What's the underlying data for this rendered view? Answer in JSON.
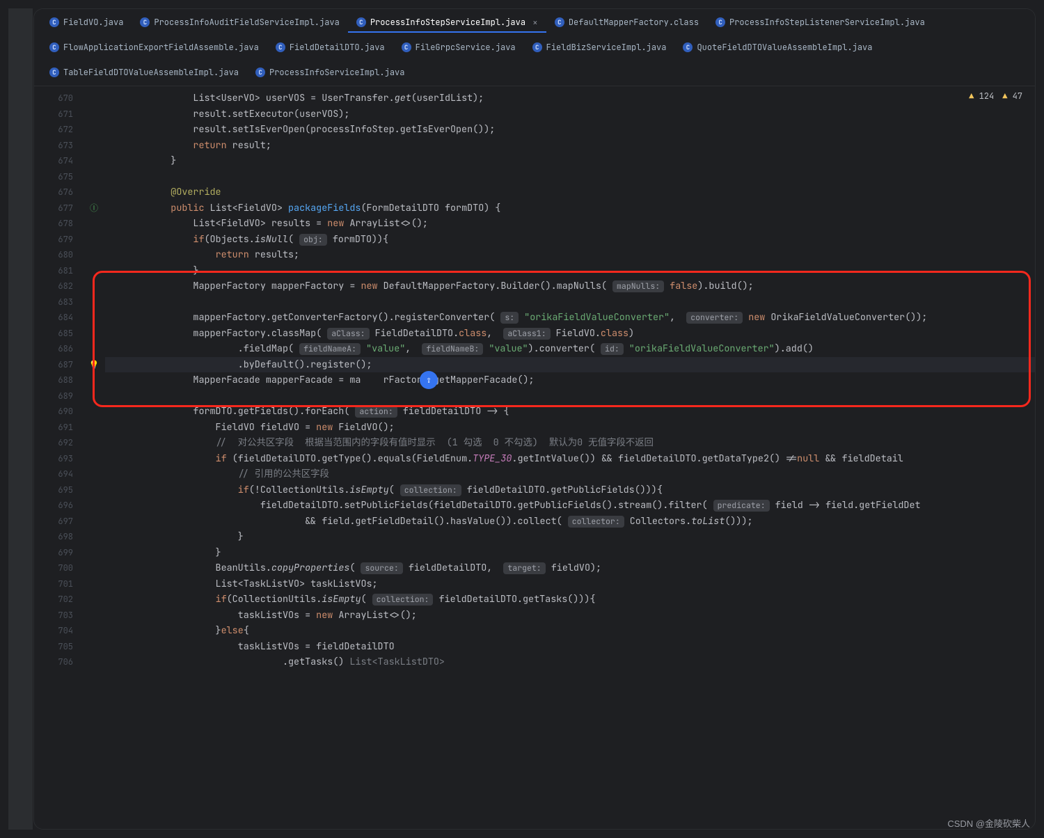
{
  "tabs_rows": [
    [
      {
        "label": "FieldVO.java",
        "active": false
      },
      {
        "label": "ProcessInfoAuditFieldServiceImpl.java",
        "active": false
      },
      {
        "label": "ProcessInfoStepServiceImpl.java",
        "active": true,
        "closable": true
      },
      {
        "label": "DefaultMapperFactory.class",
        "active": false
      },
      {
        "label": "ProcessInfoStepListenerServiceImpl.java",
        "active": false
      }
    ],
    [
      {
        "label": "FlowApplicationExportFieldAssemble.java",
        "active": false
      },
      {
        "label": "FieldDetailDTO.java",
        "active": false
      },
      {
        "label": "FileGrpcService.java",
        "active": false
      },
      {
        "label": "FieldBizServiceImpl.java",
        "active": false
      },
      {
        "label": "QuoteFieldDTOValueAssembleImpl.java",
        "active": false
      }
    ],
    [
      {
        "label": "TableFieldDTOValueAssembleImpl.java",
        "active": false
      },
      {
        "label": "ProcessInfoServiceImpl.java",
        "active": false
      }
    ]
  ],
  "inspect": {
    "warn1": "124",
    "warn2": "47"
  },
  "gutter_marks": {
    "677": "impl",
    "687": "bulb"
  },
  "highlight_line": 687,
  "lines": [
    {
      "n": 670,
      "seg": [
        {
          "t": "            List<UserVO> userVOS = UserTransfer."
        },
        {
          "t": "get",
          "c": "it"
        },
        {
          "t": "(userIdList);"
        }
      ]
    },
    {
      "n": 671,
      "seg": [
        {
          "t": "            result.setExecutor(userVOS);"
        }
      ]
    },
    {
      "n": 672,
      "seg": [
        {
          "t": "            result.setIsEverOpen(processInfoStep.getIsEverOpen());"
        }
      ]
    },
    {
      "n": 673,
      "seg": [
        {
          "t": "            "
        },
        {
          "t": "return",
          "c": "kw"
        },
        {
          "t": " result;"
        }
      ]
    },
    {
      "n": 674,
      "seg": [
        {
          "t": "        }"
        }
      ]
    },
    {
      "n": 675,
      "seg": [
        {
          "t": ""
        }
      ]
    },
    {
      "n": 676,
      "seg": [
        {
          "t": "        "
        },
        {
          "t": "@Override",
          "c": "ann"
        }
      ]
    },
    {
      "n": 677,
      "seg": [
        {
          "t": "        "
        },
        {
          "t": "public",
          "c": "kw"
        },
        {
          "t": " List<FieldVO> "
        },
        {
          "t": "packageFields",
          "c": "fn"
        },
        {
          "t": "(FormDetailDTO formDTO) {"
        }
      ]
    },
    {
      "n": 678,
      "seg": [
        {
          "t": "            List<FieldVO> results = "
        },
        {
          "t": "new",
          "c": "kw"
        },
        {
          "t": " ArrayList<>();"
        }
      ]
    },
    {
      "n": 679,
      "seg": [
        {
          "t": "            "
        },
        {
          "t": "if",
          "c": "kw"
        },
        {
          "t": "(Objects."
        },
        {
          "t": "isNull",
          "c": "it"
        },
        {
          "t": "( "
        },
        {
          "t": "obj:",
          "c": "pill"
        },
        {
          "t": " formDTO)){"
        }
      ]
    },
    {
      "n": 680,
      "seg": [
        {
          "t": "                "
        },
        {
          "t": "return",
          "c": "kw"
        },
        {
          "t": " results;"
        }
      ]
    },
    {
      "n": 681,
      "seg": [
        {
          "t": "            }"
        }
      ]
    },
    {
      "n": 682,
      "seg": [
        {
          "t": "            MapperFactory mapperFactory = "
        },
        {
          "t": "new",
          "c": "kw"
        },
        {
          "t": " DefaultMapperFactory.Builder().mapNulls( "
        },
        {
          "t": "mapNulls:",
          "c": "pill"
        },
        {
          "t": " "
        },
        {
          "t": "false",
          "c": "kw"
        },
        {
          "t": ").build();"
        }
      ]
    },
    {
      "n": 683,
      "seg": [
        {
          "t": ""
        }
      ]
    },
    {
      "n": 684,
      "seg": [
        {
          "t": "            mapperFactory.getConverterFactory().registerConverter( "
        },
        {
          "t": "s:",
          "c": "pill"
        },
        {
          "t": " "
        },
        {
          "t": "\"orikaFieldValueConverter\"",
          "c": "s"
        },
        {
          "t": ",  "
        },
        {
          "t": "converter:",
          "c": "pill"
        },
        {
          "t": " "
        },
        {
          "t": "new",
          "c": "kw"
        },
        {
          "t": " OrikaFieldValueConverter());"
        }
      ]
    },
    {
      "n": 685,
      "seg": [
        {
          "t": "            mapperFactory.classMap( "
        },
        {
          "t": "aClass:",
          "c": "pill"
        },
        {
          "t": " FieldDetailDTO."
        },
        {
          "t": "class",
          "c": "kw"
        },
        {
          "t": ",  "
        },
        {
          "t": "aClass1:",
          "c": "pill"
        },
        {
          "t": " FieldVO."
        },
        {
          "t": "class",
          "c": "kw"
        },
        {
          "t": ")"
        }
      ]
    },
    {
      "n": 686,
      "seg": [
        {
          "t": "                    .fieldMap( "
        },
        {
          "t": "fieldNameA:",
          "c": "pill"
        },
        {
          "t": " "
        },
        {
          "t": "\"value\"",
          "c": "s"
        },
        {
          "t": ",  "
        },
        {
          "t": "fieldNameB:",
          "c": "pill"
        },
        {
          "t": " "
        },
        {
          "t": "\"value\"",
          "c": "s"
        },
        {
          "t": ").converter( "
        },
        {
          "t": "id:",
          "c": "pill"
        },
        {
          "t": " "
        },
        {
          "t": "\"orikaFieldValueConverter\"",
          "c": "s"
        },
        {
          "t": ").add()"
        }
      ]
    },
    {
      "n": 687,
      "seg": [
        {
          "t": "                    .byDefault().register();"
        }
      ]
    },
    {
      "n": 688,
      "seg": [
        {
          "t": "            MapperFacade mapperFacade = ma    rFactory.getMapperFacade();"
        }
      ]
    },
    {
      "n": 689,
      "seg": [
        {
          "t": ""
        }
      ]
    },
    {
      "n": 690,
      "seg": [
        {
          "t": "            formDTO.getFields().forEach( "
        },
        {
          "t": "action:",
          "c": "pill"
        },
        {
          "t": " fieldDetailDTO -> {"
        }
      ]
    },
    {
      "n": 691,
      "seg": [
        {
          "t": "                FieldVO fieldVO = "
        },
        {
          "t": "new",
          "c": "kw"
        },
        {
          "t": " FieldVO();"
        }
      ]
    },
    {
      "n": 692,
      "seg": [
        {
          "t": "                "
        },
        {
          "t": "//  对公共区字段  根据当范围内的字段有值时显示  (1 勾选  0 不勾选)  默认为0 无值字段不返回",
          "c": "c"
        }
      ]
    },
    {
      "n": 693,
      "seg": [
        {
          "t": "                "
        },
        {
          "t": "if",
          "c": "kw"
        },
        {
          "t": " (fieldDetailDTO.getType().equals(FieldEnum."
        },
        {
          "t": "TYPE_30",
          "c": "const"
        },
        {
          "t": ".getIntValue()) && fieldDetailDTO.getDataType2() !="
        },
        {
          "t": "null",
          "c": "kw"
        },
        {
          "t": " && fieldDetail"
        }
      ]
    },
    {
      "n": 694,
      "seg": [
        {
          "t": "                    "
        },
        {
          "t": "// 引用的公共区字段",
          "c": "c"
        }
      ]
    },
    {
      "n": 695,
      "seg": [
        {
          "t": "                    "
        },
        {
          "t": "if",
          "c": "kw"
        },
        {
          "t": "(!CollectionUtils."
        },
        {
          "t": "isEmpty",
          "c": "it"
        },
        {
          "t": "( "
        },
        {
          "t": "collection:",
          "c": "pill"
        },
        {
          "t": " fieldDetailDTO.getPublicFields())){"
        }
      ]
    },
    {
      "n": 696,
      "seg": [
        {
          "t": "                        fieldDetailDTO.setPublicFields(fieldDetailDTO.getPublicFields().stream().filter( "
        },
        {
          "t": "predicate:",
          "c": "pill"
        },
        {
          "t": " field -> field.getFieldDet"
        }
      ]
    },
    {
      "n": 697,
      "seg": [
        {
          "t": "                                && field.getFieldDetail().hasValue()).collect( "
        },
        {
          "t": "collector:",
          "c": "pill"
        },
        {
          "t": " Collectors."
        },
        {
          "t": "toList",
          "c": "it"
        },
        {
          "t": "()));"
        }
      ]
    },
    {
      "n": 698,
      "seg": [
        {
          "t": "                    }"
        }
      ]
    },
    {
      "n": 699,
      "seg": [
        {
          "t": "                }"
        }
      ]
    },
    {
      "n": 700,
      "seg": [
        {
          "t": "                BeanUtils."
        },
        {
          "t": "copyProperties",
          "c": "it"
        },
        {
          "t": "( "
        },
        {
          "t": "source:",
          "c": "pill"
        },
        {
          "t": " fieldDetailDTO,  "
        },
        {
          "t": "target:",
          "c": "pill"
        },
        {
          "t": " fieldVO);"
        }
      ]
    },
    {
      "n": 701,
      "seg": [
        {
          "t": "                List<TaskListVO> taskListVOs;"
        }
      ]
    },
    {
      "n": 702,
      "seg": [
        {
          "t": "                "
        },
        {
          "t": "if",
          "c": "kw"
        },
        {
          "t": "(CollectionUtils."
        },
        {
          "t": "isEmpty",
          "c": "it"
        },
        {
          "t": "( "
        },
        {
          "t": "collection:",
          "c": "pill"
        },
        {
          "t": " fieldDetailDTO.getTasks())){"
        }
      ]
    },
    {
      "n": 703,
      "seg": [
        {
          "t": "                    taskListVOs = "
        },
        {
          "t": "new",
          "c": "kw"
        },
        {
          "t": " ArrayList<>();"
        }
      ]
    },
    {
      "n": 704,
      "seg": [
        {
          "t": "                }"
        },
        {
          "t": "else",
          "c": "kw"
        },
        {
          "t": "{"
        }
      ]
    },
    {
      "n": 705,
      "seg": [
        {
          "t": "                    taskListVOs = fieldDetailDTO"
        }
      ]
    },
    {
      "n": 706,
      "seg": [
        {
          "t": "                            .getTasks() "
        },
        {
          "t": "List<TaskListDTO>",
          "c": "c"
        }
      ]
    }
  ],
  "redbox": {
    "top_line": 681,
    "bottom_line": 689
  },
  "ai_pop_line": 688,
  "watermark": "CSDN @金陵砍柴人"
}
